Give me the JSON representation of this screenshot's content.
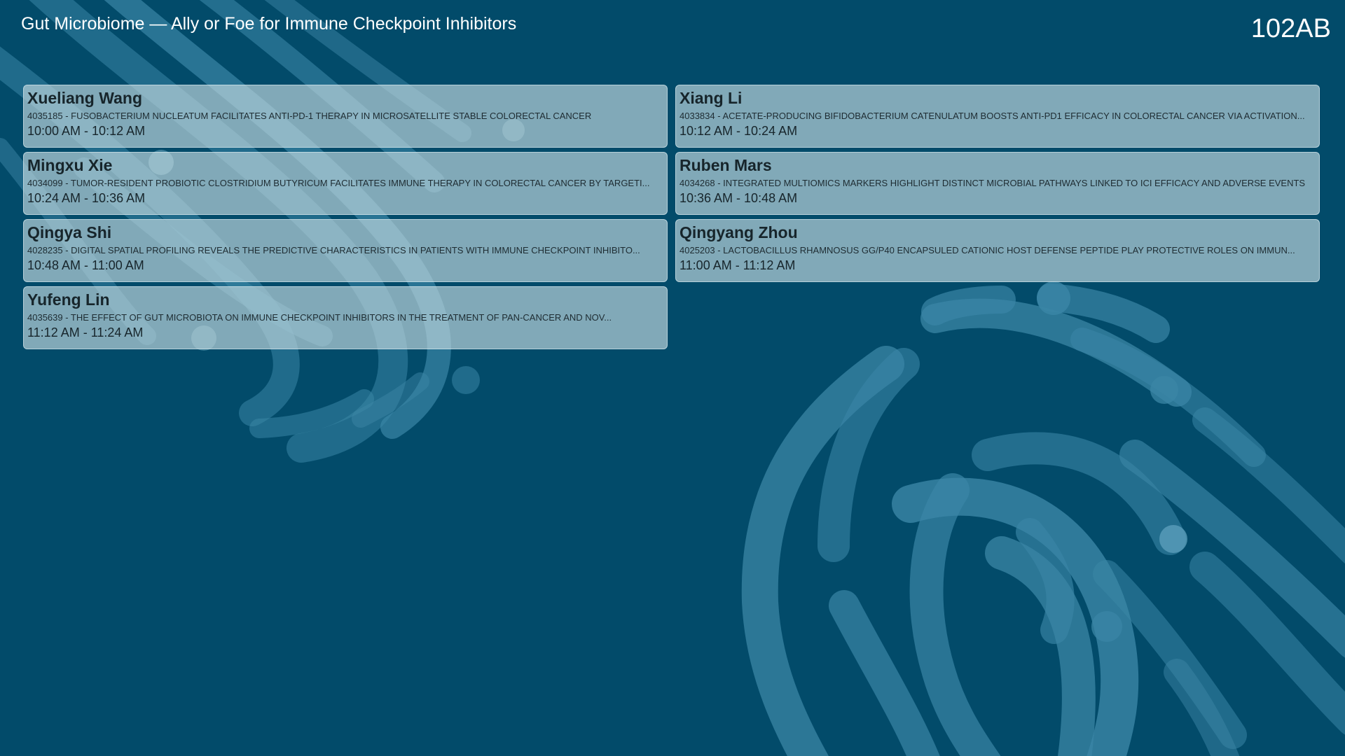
{
  "header": {
    "session_title": "Gut Microbiome — Ally or Foe for Immune Checkpoint Inhibitors",
    "room": "102AB"
  },
  "colors": {
    "background": "#024b6a",
    "pattern_light": "#3b86a6",
    "card_fill": "#c4dae0",
    "text_light": "#ffffff",
    "text_dark": "#17252b"
  },
  "presentations": [
    {
      "speaker": "Xueliang Wang",
      "title": "4035185 - FUSOBACTERIUM NUCLEATUM FACILITATES ANTI-PD-1 THERAPY IN MICROSATELLITE STABLE COLORECTAL CANCER",
      "time": "10:00 AM - 10:12 AM"
    },
    {
      "speaker": "Xiang Li",
      "title": " 4033834 - ACETATE-PRODUCING BIFIDOBACTERIUM CATENULATUM BOOSTS ANTI-PD1 EFFICACY IN COLORECTAL CANCER VIA ACTIVATION...",
      "time": "10:12 AM - 10:24 AM"
    },
    {
      "speaker": "Mingxu Xie",
      "title": " 4034099 - TUMOR-RESIDENT PROBIOTIC CLOSTRIDIUM BUTYRICUM FACILITATES IMMUNE THERAPY IN COLORECTAL CANCER BY TARGETI...",
      "time": "10:24 AM - 10:36 AM"
    },
    {
      "speaker": "Ruben Mars",
      "title": "4034268 - INTEGRATED MULTIOMICS MARKERS HIGHLIGHT DISTINCT MICROBIAL PATHWAYS LINKED TO ICI EFFICACY AND ADVERSE EVENTS",
      "time": "10:36 AM - 10:48 AM"
    },
    {
      "speaker": "Qingya Shi",
      "title": " 4028235 - DIGITAL SPATIAL PROFILING REVEALS THE PREDICTIVE CHARACTERISTICS IN PATIENTS WITH IMMUNE CHECKPOINT INHIBITO...",
      "time": "10:48 AM - 11:00 AM"
    },
    {
      "speaker": "Qingyang Zhou",
      "title": "4025203 - LACTOBACILLUS RHAMNOSUS GG/P40 ENCAPSULED CATIONIC HOST DEFENSE PEPTIDE PLAY PROTECTIVE ROLES ON IMMUN...",
      "time": "11:00 AM - 11:12 AM"
    },
    {
      "speaker": "Yufeng Lin",
      "title": " 4035639 - THE EFFECT OF GUT MICROBIOTA ON IMMUNE CHECKPOINT INHIBITORS IN THE TREATMENT OF PAN-CANCER AND NOV...",
      "time": "11:12 AM - 11:24 AM"
    }
  ]
}
